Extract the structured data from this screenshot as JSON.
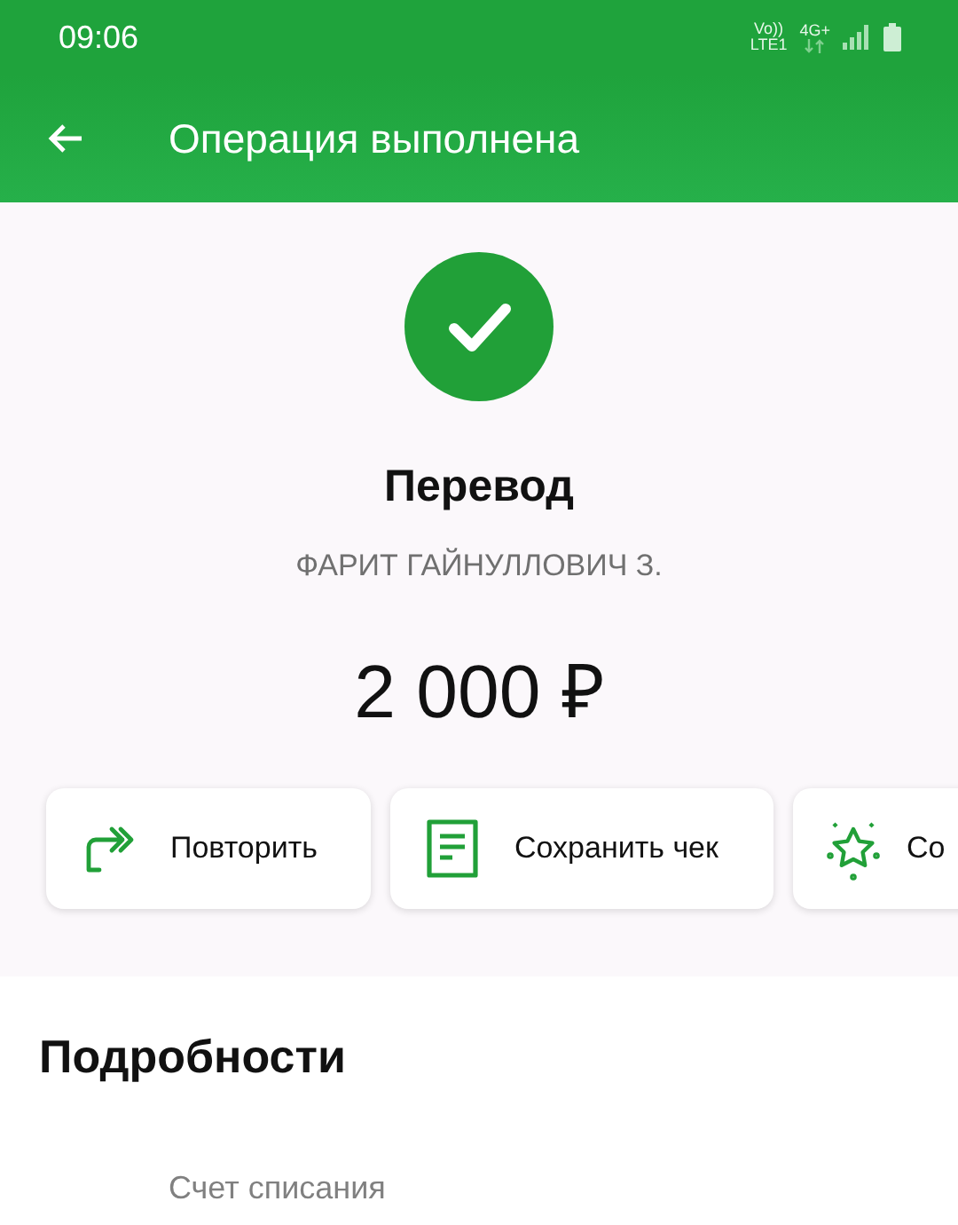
{
  "status_bar": {
    "time": "09:06",
    "volte": "Vo))",
    "network": "LTE1",
    "generation": "4G+"
  },
  "app_bar": {
    "title": "Операция выполнена"
  },
  "result": {
    "title": "Перевод",
    "recipient": "ФАРИТ ГАЙНУЛЛОВИЧ З.",
    "amount": "2 000 ₽"
  },
  "actions": [
    {
      "kind": "repeat",
      "label": "Повторить"
    },
    {
      "kind": "receipt",
      "label": "Сохранить чек"
    },
    {
      "kind": "star",
      "label": "Со"
    }
  ],
  "details": {
    "title": "Подробности",
    "fields": [
      {
        "label": "Счет списания"
      }
    ]
  }
}
